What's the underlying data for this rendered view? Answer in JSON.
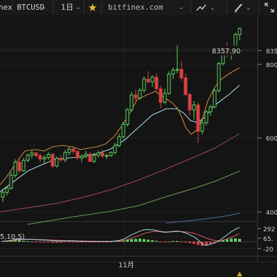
{
  "toolbar": {
    "symbol": "nex BTCUSD",
    "interval": "1日",
    "site": "bitfinex.com"
  },
  "price_axis": {
    "labels": [
      "835",
      "800",
      "600",
      "400"
    ],
    "last_price": "8357.90"
  },
  "oscillator": {
    "params": "5,10,5)",
    "labels": [
      "292",
      "65.",
      "-20"
    ]
  },
  "time_axis": {
    "labels": [
      "11月"
    ]
  },
  "colors": {
    "up": "#5fd35f",
    "down": "#d94040",
    "ma_short": "#c9853f",
    "ma_mid": "#a6d8ec",
    "ma_long": "#a04a58",
    "ma_longer": "#6f9f57",
    "ma_longest": "#4a6fa8"
  },
  "chart_data": {
    "type": "candlestick",
    "ylim": [
      3650,
      8700
    ],
    "candles": [
      [
        4000,
        4170,
        3870,
        4120
      ],
      [
        4120,
        4280,
        4040,
        4230
      ],
      [
        4230,
        4650,
        4180,
        4560
      ],
      [
        4560,
        4980,
        4500,
        4900
      ],
      [
        4900,
        5020,
        4620,
        4680
      ],
      [
        4680,
        5010,
        4650,
        4950
      ],
      [
        4950,
        5120,
        4900,
        5080
      ],
      [
        5080,
        5210,
        5000,
        5140
      ],
      [
        5140,
        5170,
        5030,
        5070
      ],
      [
        5070,
        5130,
        4900,
        4980
      ],
      [
        4980,
        5080,
        4860,
        5020
      ],
      [
        5020,
        5160,
        4960,
        5100
      ],
      [
        5100,
        5140,
        4740,
        4800
      ],
      [
        4800,
        5050,
        4760,
        5000
      ],
      [
        5000,
        5080,
        4900,
        4960
      ],
      [
        4960,
        5210,
        4900,
        5150
      ],
      [
        5150,
        5290,
        5080,
        5240
      ],
      [
        5240,
        5320,
        5100,
        5180
      ],
      [
        5180,
        5200,
        4960,
        5010
      ],
      [
        5010,
        5100,
        4900,
        5060
      ],
      [
        5060,
        5190,
        5000,
        5110
      ],
      [
        5110,
        5160,
        4900,
        4920
      ],
      [
        4920,
        5140,
        4880,
        5080
      ],
      [
        5080,
        5200,
        5020,
        5140
      ],
      [
        5140,
        5220,
        5010,
        5060
      ],
      [
        5060,
        5120,
        4980,
        5070
      ],
      [
        5070,
        5180,
        5040,
        5150
      ],
      [
        5150,
        5400,
        5100,
        5330
      ],
      [
        5330,
        5640,
        5280,
        5560
      ],
      [
        5560,
        5950,
        5500,
        5880
      ],
      [
        5880,
        6300,
        5820,
        6260
      ],
      [
        6260,
        6720,
        6200,
        6640
      ],
      [
        6640,
        6780,
        6420,
        6560
      ],
      [
        6560,
        6820,
        6520,
        6760
      ],
      [
        6760,
        7120,
        6700,
        7050
      ],
      [
        7050,
        7250,
        6920,
        6980
      ],
      [
        6980,
        7150,
        6850,
        7100
      ],
      [
        7100,
        7200,
        6700,
        6800
      ],
      [
        6800,
        6880,
        6300,
        6450
      ],
      [
        6450,
        6800,
        6400,
        6680
      ],
      [
        6680,
        7250,
        6640,
        7180
      ],
      [
        7180,
        7350,
        7050,
        7280
      ],
      [
        7280,
        7920,
        7200,
        7300
      ],
      [
        7300,
        7520,
        7000,
        7080
      ],
      [
        7080,
        7180,
        6600,
        6650
      ],
      [
        6650,
        6700,
        6100,
        6250
      ],
      [
        6250,
        6480,
        6000,
        6380
      ],
      [
        6380,
        6450,
        5400,
        5700
      ],
      [
        5700,
        6000,
        5620,
        5920
      ],
      [
        5920,
        6250,
        5850,
        6200
      ],
      [
        6200,
        6380,
        6100,
        6330
      ],
      [
        6330,
        6800,
        6300,
        6750
      ],
      [
        6750,
        7500,
        6700,
        7450
      ],
      [
        7450,
        7900,
        7400,
        7850
      ],
      [
        7850,
        8000,
        7600,
        7700
      ],
      [
        7700,
        7850,
        7550,
        7820
      ],
      [
        7820,
        8250,
        7780,
        8200
      ],
      [
        8200,
        8380,
        8050,
        8357.9
      ]
    ],
    "oscillator": {
      "diff": [
        8,
        12,
        22,
        40,
        42,
        40,
        39,
        37,
        33,
        28,
        25,
        23,
        15,
        13,
        11,
        12,
        14,
        13,
        8,
        6,
        6,
        3,
        4,
        6,
        5,
        4,
        5,
        10,
        20,
        40,
        70,
        110,
        140,
        170,
        190,
        195,
        190,
        180,
        160,
        150,
        155,
        165,
        170,
        160,
        140,
        110,
        80,
        30,
        -40,
        -60,
        -40,
        -20,
        10,
        60,
        110,
        160,
        200,
        230
      ],
      "dea": [
        5,
        7,
        12,
        22,
        30,
        35,
        37,
        37,
        36,
        34,
        31,
        29,
        25,
        22,
        19,
        17,
        16,
        15,
        13,
        11,
        10,
        8,
        7,
        7,
        6,
        6,
        6,
        7,
        10,
        18,
        32,
        55,
        80,
        105,
        130,
        150,
        160,
        165,
        164,
        160,
        158,
        160,
        163,
        162,
        157,
        148,
        135,
        112,
        85,
        55,
        35,
        20,
        15,
        25,
        45,
        70,
        100,
        130
      ],
      "hist": [
        20,
        30,
        50,
        70,
        50,
        30,
        20,
        -10,
        -20,
        -30,
        -30,
        -30,
        -40,
        -40,
        -30,
        -20,
        -10,
        -10,
        -20,
        -20,
        -20,
        -20,
        -20,
        -10,
        -10,
        -10,
        -10,
        10,
        30,
        50,
        80,
        90,
        100,
        110,
        90,
        70,
        50,
        30,
        -10,
        -20,
        -10,
        10,
        20,
        -10,
        -30,
        -50,
        -80,
        -120,
        -150,
        -130,
        -70,
        -40,
        30,
        60,
        90,
        110,
        120,
        100
      ]
    }
  }
}
